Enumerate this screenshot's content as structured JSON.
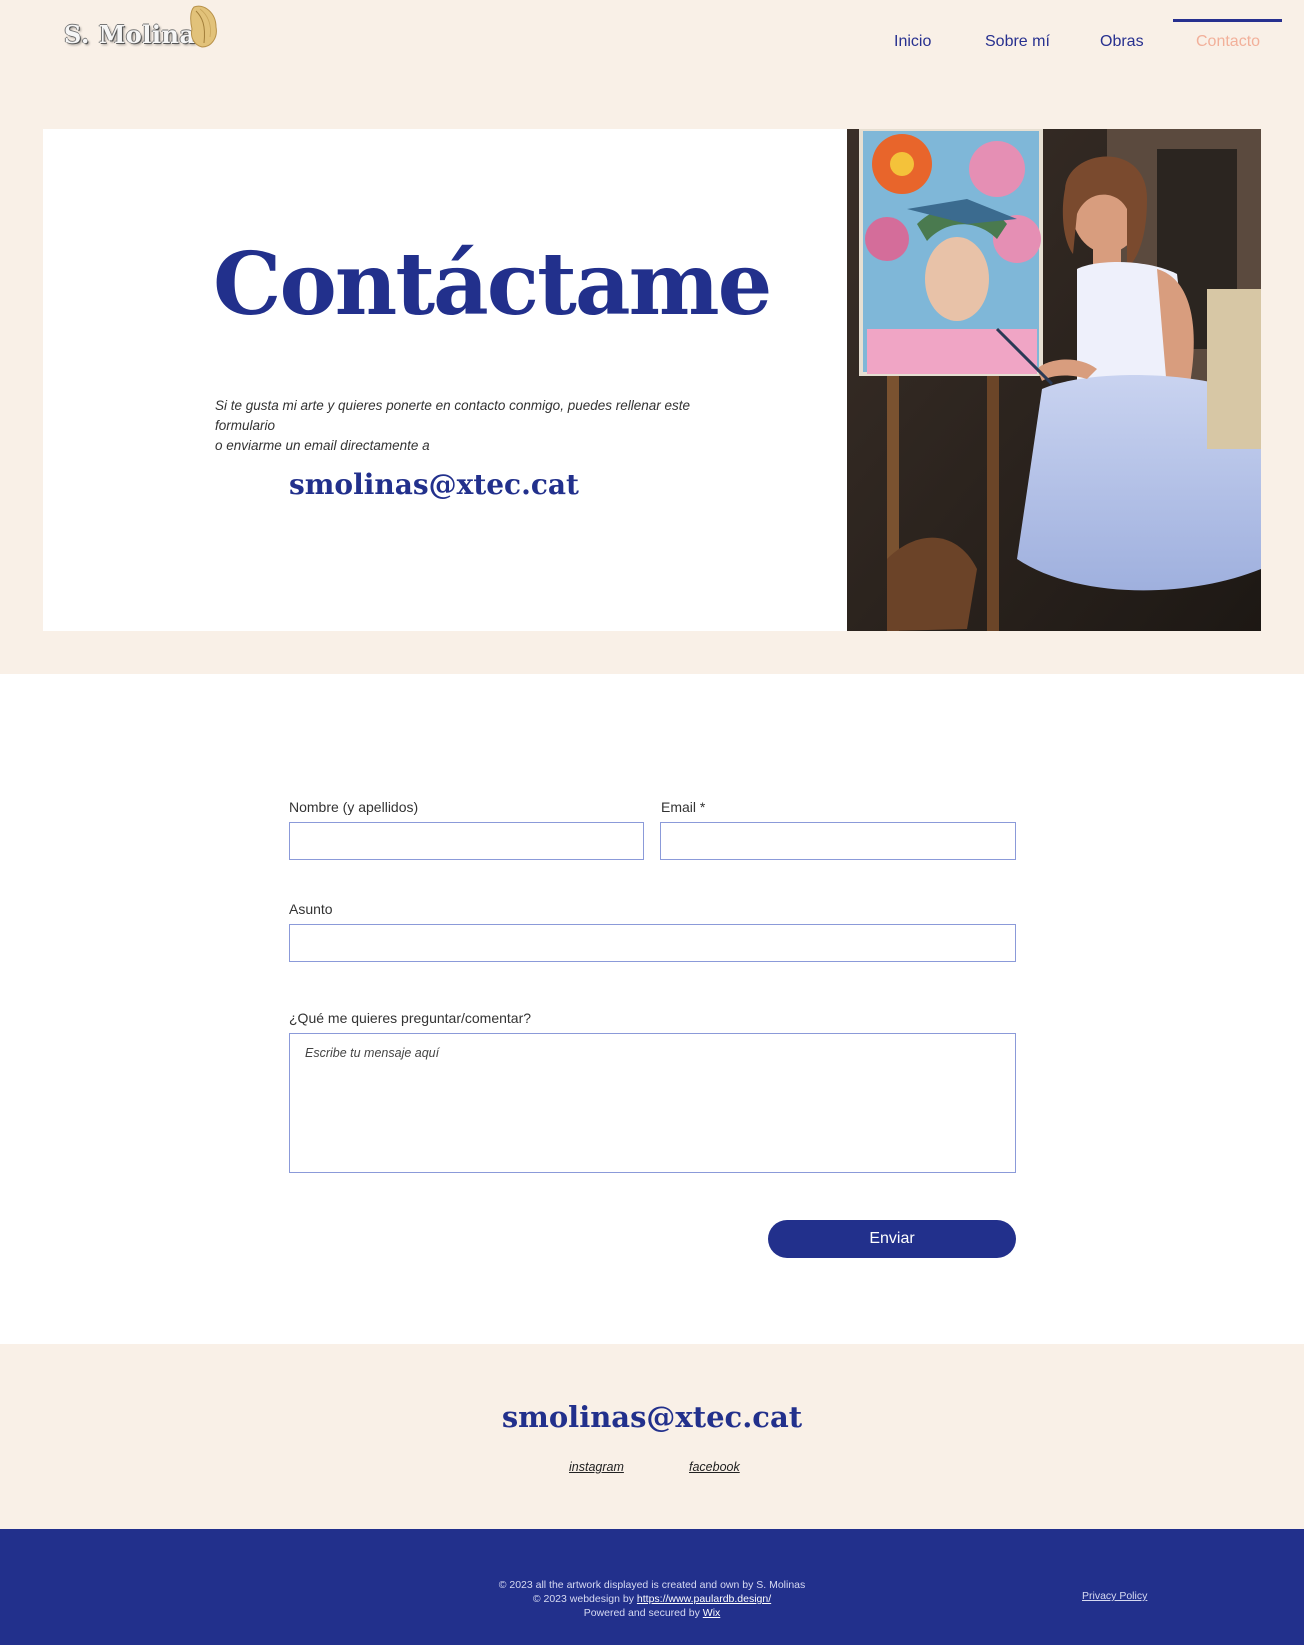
{
  "header": {
    "logo_text": "S. Molinas",
    "nav": [
      {
        "label": "Inicio"
      },
      {
        "label": "Sobre mí"
      },
      {
        "label": "Obras"
      },
      {
        "label": "Contacto",
        "active": true
      }
    ]
  },
  "hero": {
    "title": "Contáctame",
    "text_line1": "Si te gusta mi arte y quieres ponerte en contacto conmigo, puedes rellenar este formulario",
    "text_line2": "o enviarme un email directamente a",
    "email": "smolinas@xtec.cat"
  },
  "form": {
    "name_label": "Nombre (y apellidos)",
    "email_label": "Email *",
    "subject_label": "Asunto",
    "message_label": "¿Qué me quieres preguntar/comentar?",
    "message_placeholder": "Escribe tu mensaje aquí",
    "submit_label": "Enviar"
  },
  "footer": {
    "email": "smolinas@xtec.cat",
    "instagram": " instagram",
    "facebook": "facebook",
    "copyright_line1": "© 2023 all the artwork displayed is created and own by S. Molinas",
    "copyright_line2_prefix": "© 2023 webdesign  by ",
    "designer_link": "https://www.paulardb.design/",
    "copyright_line3_prefix": "Powered and secured by ",
    "wix_link": "Wix",
    "privacy": "Privacy Policy"
  },
  "colors": {
    "background": "#f9f0e7",
    "brand_blue": "#22308c",
    "active_nav": "#f2b09a",
    "field_border": "#8b9ad9"
  }
}
